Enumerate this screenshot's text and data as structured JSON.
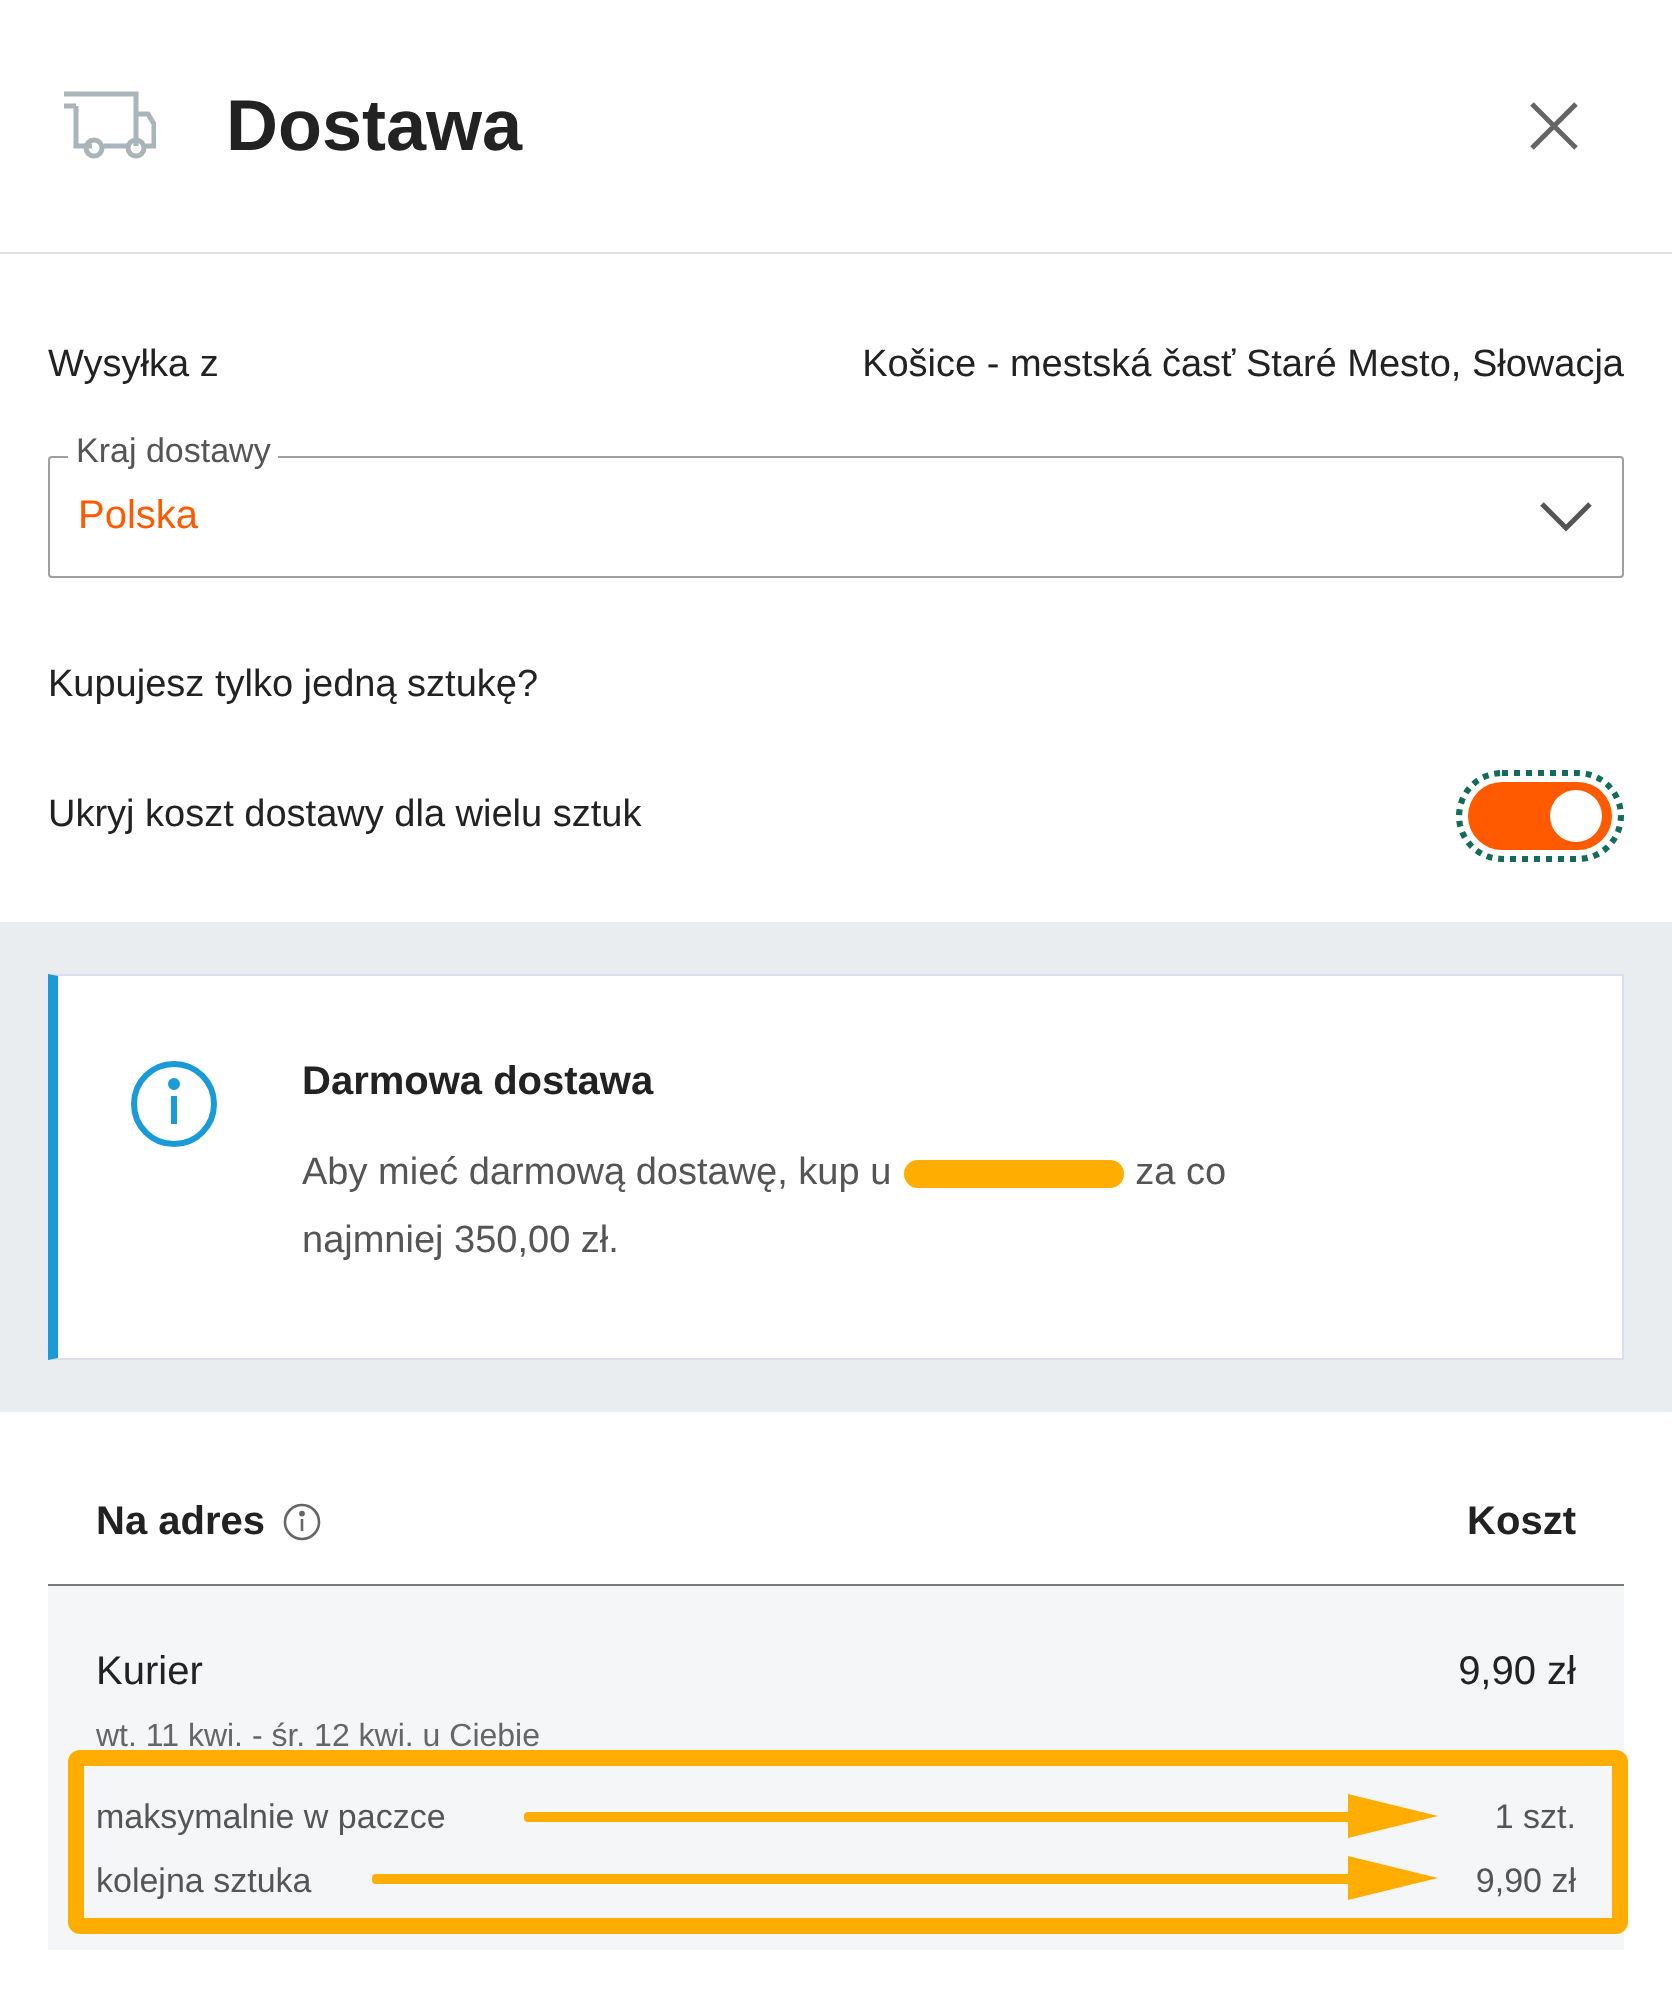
{
  "header": {
    "title": "Dostawa"
  },
  "origin": {
    "label": "Wysyłka z",
    "value": "Košice - mestská časť Staré Mesto, Słowacja"
  },
  "country_field": {
    "label": "Kraj dostawy",
    "value": "Polska"
  },
  "question": "Kupujesz tylko jedną sztukę?",
  "hide_cost_toggle": {
    "label": "Ukryj koszt dostawy dla wielu sztuk",
    "on": true,
    "focused": true
  },
  "notice": {
    "title": "Darmowa dostawa",
    "text_before": "Aby mieć darmową dostawę, kup u",
    "seller_redacted": true,
    "text_after": "za co",
    "text_line2": "najmniej 350,00 zł."
  },
  "table": {
    "columns": [
      "Na adres",
      "Koszt"
    ],
    "rows": [
      {
        "method": "Kurier",
        "price": "9,90 zł",
        "eta": "wt. 11 kwi. - śr. 12 kwi. u Ciebie",
        "details": [
          {
            "label": "maksymalnie w paczce",
            "value": "1 szt."
          },
          {
            "label": "kolejna sztuka",
            "value": "9,90 zł"
          }
        ]
      }
    ]
  },
  "annotation": {
    "highlight": true
  }
}
